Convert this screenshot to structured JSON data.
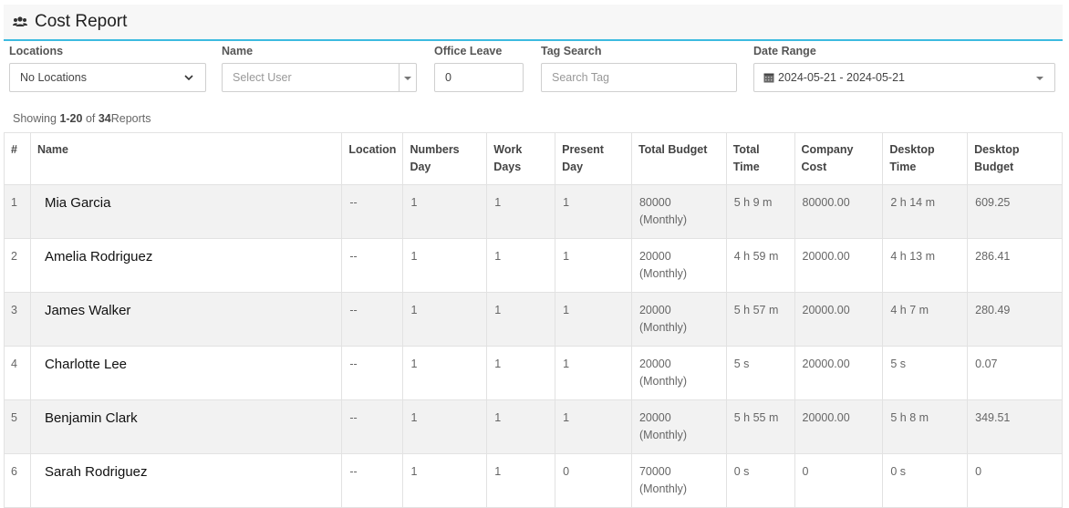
{
  "header": {
    "title": "Cost Report",
    "icon": "users-icon"
  },
  "filters": {
    "locations": {
      "label": "Locations",
      "value": "No Locations"
    },
    "name": {
      "label": "Name",
      "placeholder": "Select User"
    },
    "office_leave": {
      "label": "Office Leave",
      "value": "0"
    },
    "tag_search": {
      "label": "Tag Search",
      "placeholder": "Search Tag"
    },
    "date_range": {
      "label": "Date Range",
      "value": "2024-05-21 - 2024-05-21",
      "icon": "calendar-icon"
    }
  },
  "summary": {
    "prefix": "Showing ",
    "range": "1-20",
    "of": " of ",
    "total": "34",
    "suffix": "Reports"
  },
  "table": {
    "columns": [
      [
        "#"
      ],
      [
        "Name"
      ],
      [
        "Location"
      ],
      [
        "Numbers",
        "Day"
      ],
      [
        "Work",
        "Days"
      ],
      [
        "Present",
        "Day"
      ],
      [
        "Total Budget"
      ],
      [
        "Total",
        "Time"
      ],
      [
        "Company",
        "Cost"
      ],
      [
        "Desktop",
        "Time"
      ],
      [
        "Desktop",
        "Budget"
      ]
    ],
    "rows": [
      {
        "idx": "1",
        "name": "Mia Garcia",
        "location": "--",
        "numbers_day": "1",
        "work_days": "1",
        "present_day": "1",
        "budget": "80000",
        "budget_period": "(Monthly)",
        "total_time": "5 h 9 m",
        "company_cost": "80000.00",
        "desktop_time": "2 h 14 m",
        "desktop_budget": "609.25"
      },
      {
        "idx": "2",
        "name": "Amelia Rodriguez",
        "location": "--",
        "numbers_day": "1",
        "work_days": "1",
        "present_day": "1",
        "budget": "20000",
        "budget_period": "(Monthly)",
        "total_time": "4 h 59 m",
        "company_cost": "20000.00",
        "desktop_time": "4 h 13 m",
        "desktop_budget": "286.41"
      },
      {
        "idx": "3",
        "name": "James Walker",
        "location": "--",
        "numbers_day": "1",
        "work_days": "1",
        "present_day": "1",
        "budget": "20000",
        "budget_period": "(Monthly)",
        "total_time": "5 h 57 m",
        "company_cost": "20000.00",
        "desktop_time": "4 h 7 m",
        "desktop_budget": "280.49"
      },
      {
        "idx": "4",
        "name": "Charlotte Lee",
        "location": "--",
        "numbers_day": "1",
        "work_days": "1",
        "present_day": "1",
        "budget": "20000",
        "budget_period": "(Monthly)",
        "total_time": "5 s",
        "company_cost": "20000.00",
        "desktop_time": "5 s",
        "desktop_budget": "0.07"
      },
      {
        "idx": "5",
        "name": "Benjamin Clark",
        "location": "--",
        "numbers_day": "1",
        "work_days": "1",
        "present_day": "1",
        "budget": "20000",
        "budget_period": "(Monthly)",
        "total_time": "5 h 55 m",
        "company_cost": "20000.00",
        "desktop_time": "5 h 8 m",
        "desktop_budget": "349.51"
      },
      {
        "idx": "6",
        "name": "Sarah Rodriguez",
        "location": "--",
        "numbers_day": "1",
        "work_days": "1",
        "present_day": "0",
        "budget": "70000",
        "budget_period": "(Monthly)",
        "total_time": "0 s",
        "company_cost": "0",
        "desktop_time": "0 s",
        "desktop_budget": "0"
      }
    ]
  },
  "colors": {
    "accent": "#3dbbe0",
    "header_bg": "#f7f7f7",
    "row_alt": "#f2f2f2"
  }
}
